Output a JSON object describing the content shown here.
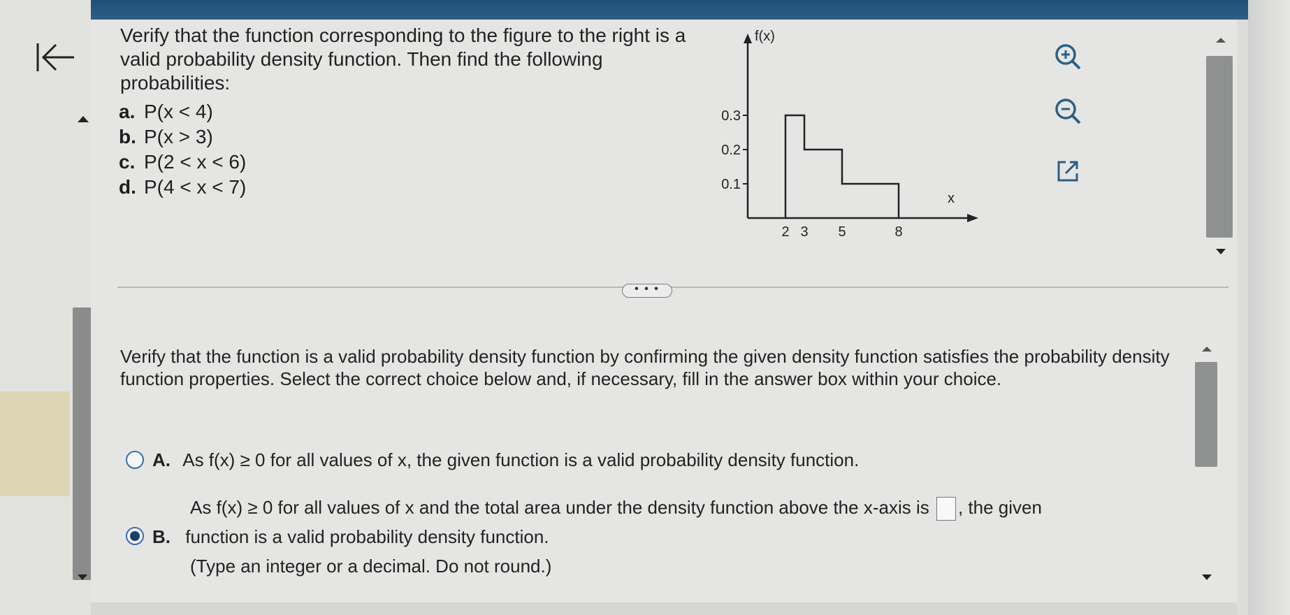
{
  "question": {
    "prompt": "Verify that the function corresponding to the figure to the right is a valid probability density function. Then find the following probabilities:",
    "parts": [
      {
        "letter": "a.",
        "text": "P(x < 4)"
      },
      {
        "letter": "b.",
        "text": "P(x > 3)"
      },
      {
        "letter": "c.",
        "text": "P(2 < x < 6)"
      },
      {
        "letter": "d.",
        "text": "P(4 < x < 7)"
      }
    ]
  },
  "graph": {
    "y_axis_label": "f(x)",
    "x_axis_label": "x",
    "y_ticks": [
      "0.3",
      "0.2",
      "0.1"
    ],
    "x_ticks": [
      "2",
      "3",
      "5",
      "8"
    ]
  },
  "chart_data": {
    "type": "area",
    "title": "",
    "xlabel": "x",
    "ylabel": "f(x)",
    "x": [
      2,
      3,
      5,
      8
    ],
    "steps": [
      {
        "x_start": 2,
        "x_end": 3,
        "value": 0.3
      },
      {
        "x_start": 3,
        "x_end": 5,
        "value": 0.2
      },
      {
        "x_start": 5,
        "x_end": 8,
        "value": 0.1
      }
    ],
    "ylim": [
      0,
      0.35
    ],
    "xlim": [
      0,
      11
    ]
  },
  "tools": {
    "zoom_in": "zoom-in-icon",
    "zoom_out": "zoom-out-icon",
    "popout": "popout-icon"
  },
  "more_label": "• • •",
  "instructions": "Verify that the function is a valid probability density function by confirming the given density function satisfies the probability density function properties. Select the correct choice below and, if necessary, fill in the answer box within your choice.",
  "choices": [
    {
      "letter": "A.",
      "text": "As f(x) ≥ 0 for all values of x, the given function is a valid probability density function.",
      "selected": false
    },
    {
      "letter": "B.",
      "text_before": "As f(x) ≥ 0 for all values of x and the total area under the density function above the x-axis is",
      "text_after": ", the given",
      "text_line2": "function is a valid probability density function.",
      "hint": "(Type an integer or a decimal. Do not round.)",
      "answer_value": "",
      "selected": true
    }
  ],
  "colors": {
    "accent": "#1d3d6e",
    "topbar": "#1f4f76"
  }
}
